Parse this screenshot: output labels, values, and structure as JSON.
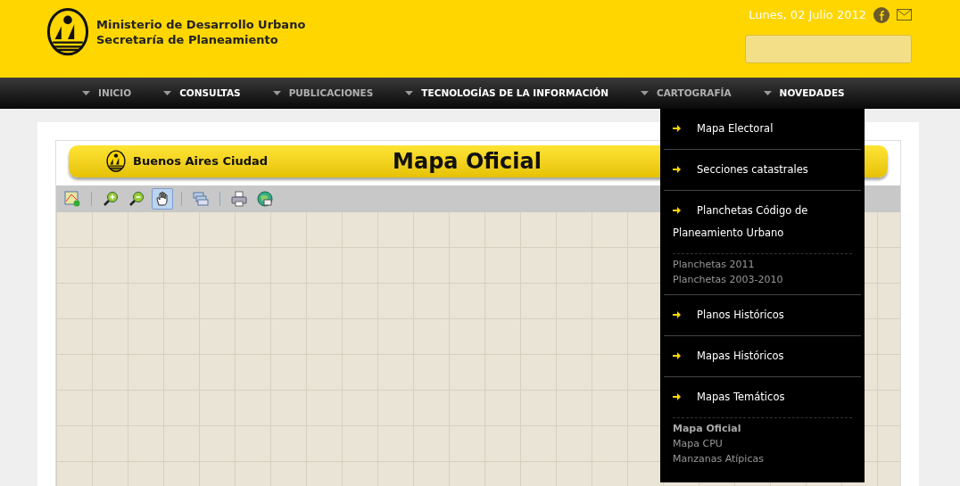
{
  "header": {
    "title_lines": [
      "Ministerio de Desarrollo Urbano",
      "Secretaría de Planeamiento"
    ],
    "date": "Lunes, 02 Julio 2012"
  },
  "nav": [
    {
      "label": "INICIO",
      "dimmed": true
    },
    {
      "label": "CONSULTAS",
      "dimmed": false
    },
    {
      "label": "PUBLICACIONES",
      "dimmed": true
    },
    {
      "label": "TECNOLOGÍAS DE LA INFORMACIÓN",
      "dimmed": false
    },
    {
      "label": "CARTOGRAFÍA",
      "dimmed": true
    },
    {
      "label": "NOVEDADES",
      "dimmed": false
    }
  ],
  "dropdown": [
    {
      "label": "Mapa Electoral"
    },
    {
      "label": "Secciones catastrales"
    },
    {
      "label": "Planchetas Código de Planeamiento Urbano",
      "children": [
        {
          "label": "Planchetas 2011",
          "selected": false
        },
        {
          "label": "Planchetas 2003-2010",
          "selected": false
        }
      ]
    },
    {
      "label": "Planos Históricos"
    },
    {
      "label": "Mapas Históricos"
    },
    {
      "label": "Mapas Temáticos",
      "children": [
        {
          "label": "Mapa Oficial",
          "selected": true
        },
        {
          "label": "Mapa CPU",
          "selected": false
        },
        {
          "label": "Manzanas Atípicas",
          "selected": false
        }
      ]
    }
  ],
  "map_banner": {
    "brand": "Buenos Aires Ciudad",
    "title": "Mapa Oficial"
  },
  "toolbar": [
    {
      "kind": "layers",
      "selected": false
    },
    {
      "kind": "sep"
    },
    {
      "kind": "zoom-in",
      "selected": false
    },
    {
      "kind": "zoom-out",
      "selected": false
    },
    {
      "kind": "pan",
      "selected": true
    },
    {
      "kind": "sep"
    },
    {
      "kind": "windows",
      "selected": false
    },
    {
      "kind": "sep"
    },
    {
      "kind": "print",
      "selected": false
    },
    {
      "kind": "globe",
      "selected": false
    }
  ]
}
